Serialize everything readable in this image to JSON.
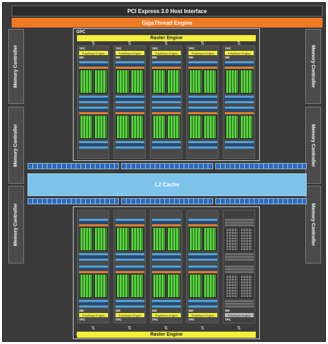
{
  "top": {
    "pcie_label": "PCI Express 3.0 Host Interface",
    "gigathread_label": "GigaThread Engine"
  },
  "memory_controllers": {
    "label": "Memory Controller",
    "left_count": 3,
    "right_count": 3
  },
  "l2": {
    "label": "L2 Cache"
  },
  "gpcs": [
    {
      "label": "GPC",
      "raster_label": "Raster Engine",
      "tpc_label": "TPC",
      "polymorph_label": "PolyMorph Engine",
      "sm_label": "SM",
      "tpcs_enabled": [
        true,
        true,
        true,
        true,
        true
      ]
    },
    {
      "label": "GPC",
      "raster_label": "Raster Engine",
      "tpc_label": "TPC",
      "polymorph_label": "PolyMorph Engine",
      "sm_label": "SM",
      "tpcs_enabled": [
        true,
        true,
        true,
        true,
        false
      ]
    }
  ],
  "colors": {
    "background": "#3a3a3a",
    "gigathread": "#f07a22",
    "raster": "#f2ef3a",
    "l2": "#7dc3ea",
    "cuda_core": "#55d43a",
    "register_blue": "#4aa3df",
    "disabled": "#7a7a7a"
  }
}
